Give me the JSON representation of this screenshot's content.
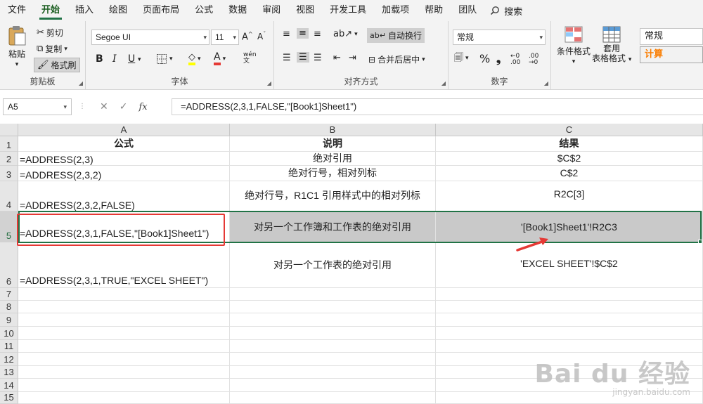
{
  "menu": {
    "tabs": [
      "文件",
      "开始",
      "插入",
      "绘图",
      "页面布局",
      "公式",
      "数据",
      "审阅",
      "视图",
      "开发工具",
      "加载项",
      "帮助",
      "团队"
    ],
    "active_tab": "开始",
    "search_label": "搜索"
  },
  "ribbon": {
    "clipboard": {
      "paste": "粘贴",
      "cut": "剪切",
      "copy": "复制",
      "format_painter": "格式刷",
      "label": "剪贴板"
    },
    "font": {
      "font_name": "Segoe UI",
      "font_size": "11",
      "bold": "B",
      "italic": "I",
      "underline": "U",
      "label": "字体",
      "font_color": "#e53935"
    },
    "alignment": {
      "wrap_text": "自动换行",
      "merge_center": "合并后居中",
      "label": "对齐方式"
    },
    "number": {
      "format": "常规",
      "label": "数字"
    },
    "styles": {
      "conditional": "条件格式",
      "table_format_1": "套用",
      "table_format_2": "表格格式",
      "style_normal": "常规",
      "style_calc": "计算"
    }
  },
  "formula_bar": {
    "name_box": "A5",
    "formula": "=ADDRESS(2,3,1,FALSE,\"[Book1]Sheet1\")"
  },
  "sheet": {
    "columns": [
      "A",
      "B",
      "C"
    ],
    "rows": [
      "1",
      "2",
      "3",
      "4",
      "5",
      "6",
      "7",
      "8",
      "9",
      "10",
      "11",
      "12",
      "13",
      "14",
      "15"
    ],
    "cells": {
      "A1": "公式",
      "B1": "说明",
      "C1": "结果",
      "A2": "=ADDRESS(2,3)",
      "B2": "绝对引用",
      "C2": "$C$2",
      "A3": "=ADDRESS(2,3,2)",
      "B3": "绝对行号，相对列标",
      "C3": "C$2",
      "A4": "=ADDRESS(2,3,2,FALSE)",
      "B4": "绝对行号，R1C1 引用样式中的相对列标",
      "C4": "R2C[3]",
      "A5": "=ADDRESS(2,3,1,FALSE,\"[Book1]Sheet1\")",
      "B5": "对另一个工作簿和工作表的绝对引用",
      "C5": "'[Book1]Sheet1'!R2C3",
      "A6": "=ADDRESS(2,3,1,TRUE,\"EXCEL SHEET\")",
      "B6": "对另一个工作表的绝对引用",
      "C6": "'EXCEL SHEET'!$C$2"
    },
    "selected_row": "5",
    "highlight_color": "#e53935",
    "selection_color": "#217346"
  },
  "watermark": {
    "logo": "Bai du 经验",
    "url": "jingyan.baidu.com"
  }
}
